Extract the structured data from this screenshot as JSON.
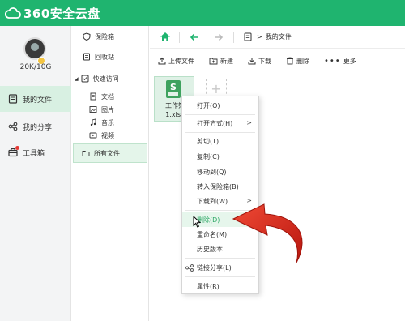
{
  "app": {
    "logo_text": "360安全云盘",
    "brand_color": "#1fb46f"
  },
  "user": {
    "quota": "20K/10G"
  },
  "leftnav": {
    "items": [
      {
        "label": "我的文件",
        "icon": "file-list-icon",
        "active": true
      },
      {
        "label": "我的分享",
        "icon": "share-icon",
        "active": false
      },
      {
        "label": "工具箱",
        "icon": "toolbox-icon",
        "active": false
      }
    ]
  },
  "tree": {
    "items": [
      {
        "label": "保险箱",
        "icon": "safe-icon"
      },
      {
        "label": "回收站",
        "icon": "recycle-bin-icon"
      },
      {
        "label": "快速访问",
        "icon": "quick-access-icon"
      },
      {
        "label": "文档",
        "icon": "document-icon"
      },
      {
        "label": "图片",
        "icon": "image-icon"
      },
      {
        "label": "音乐",
        "icon": "music-icon"
      },
      {
        "label": "视频",
        "icon": "video-icon"
      },
      {
        "label": "所有文件",
        "icon": "folder-icon"
      }
    ]
  },
  "toolbar": {
    "breadcrumb_sep": ">",
    "current_path": "我的文件"
  },
  "actions": {
    "upload": "上传文件",
    "new": "新建",
    "download": "下载",
    "delete": "删除",
    "more": "更多"
  },
  "file": {
    "name": "工作簿1.xlsx",
    "name_line1": "工作簿",
    "name_line2": "1.xlsx",
    "icon_letter": "S",
    "icon": "spreadsheet-icon"
  },
  "context_menu": {
    "items": [
      {
        "label": "打开(O)"
      },
      {
        "label": "打开方式(H)",
        "submenu": true
      },
      {
        "label": "剪切(T)"
      },
      {
        "label": "复制(C)"
      },
      {
        "label": "移动到(Q)"
      },
      {
        "label": "转入保险箱(B)"
      },
      {
        "label": "下载到(W)",
        "submenu": true
      },
      {
        "label": "删除(D)",
        "highlighted": true
      },
      {
        "label": "重命名(M)"
      },
      {
        "label": "历史版本"
      },
      {
        "label": "链接分享(L)",
        "icon": "link-share-icon"
      },
      {
        "label": "属性(R)"
      }
    ],
    "submenu_arrow": ">"
  },
  "annotation": {
    "arrow_color": "#d62b1f"
  }
}
